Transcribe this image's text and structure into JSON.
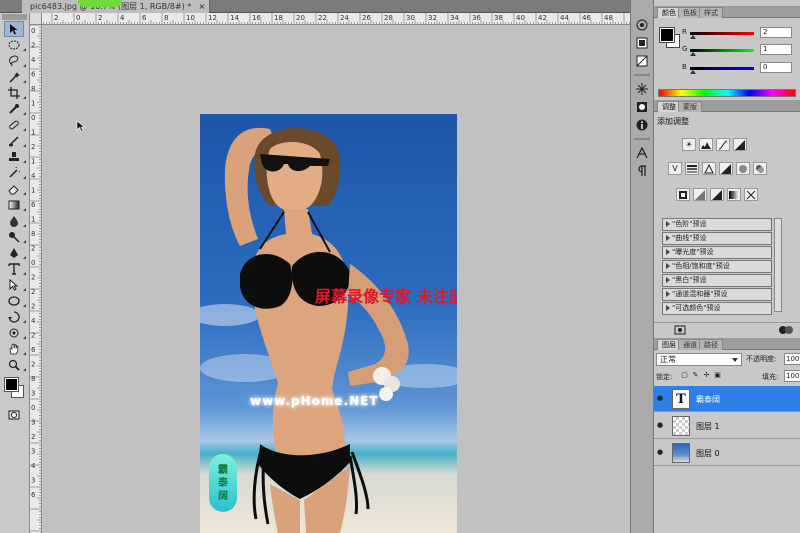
{
  "tabbar": {
    "doc_tab_label": "pic6483.jpg @ 16.7% (图层 1, RGB/8#) *",
    "close_glyph": "×"
  },
  "tools": [
    "move",
    "marquee",
    "lasso",
    "magic-wand",
    "crop",
    "eyedropper",
    "healing",
    "brush",
    "stamp",
    "history-brush",
    "eraser",
    "gradient",
    "blur",
    "dodge",
    "pen",
    "type",
    "path-select",
    "shape",
    "3d-rotate",
    "3d-camera",
    "hand",
    "zoom"
  ],
  "ruler": {
    "top_labels": [
      "4",
      "2",
      "0",
      "2",
      "4",
      "6",
      "8",
      "10",
      "12",
      "14",
      "16",
      "18",
      "20",
      "22",
      "24",
      "26",
      "28",
      "30",
      "32",
      "34",
      "36",
      "38",
      "40",
      "42",
      "44",
      "46",
      "48"
    ],
    "left_labels": [
      "0",
      "2",
      "4",
      "6",
      "8",
      "1",
      "0",
      "1",
      "2",
      "1",
      "4",
      "1",
      "6",
      "1",
      "8",
      "2",
      "0",
      "2",
      "2",
      "2",
      "4",
      "2",
      "6",
      "2",
      "8",
      "3",
      "0",
      "3",
      "2",
      "3",
      "4",
      "3",
      "6"
    ]
  },
  "canvas": {
    "watermark_text": "屏幕录像专家 未注册",
    "site_text": "www.pHome.NET",
    "seal_chars": [
      "霸",
      "泰",
      "阔"
    ]
  },
  "strip": {
    "icons": [
      "color-panel-icon",
      "swatches-icon",
      "styles-icon",
      "adjustments-icon",
      "masks-icon",
      "info-icon",
      "character-icon",
      "paragraph-icon"
    ]
  },
  "color_panel": {
    "tabs": [
      "颜色",
      "色板",
      "样式"
    ],
    "active_tab": 0,
    "channels": [
      {
        "label": "R",
        "value": "2",
        "color": "#d00000"
      },
      {
        "label": "G",
        "value": "1",
        "color": "#00a000"
      },
      {
        "label": "B",
        "value": "0",
        "color": "#0000c0"
      }
    ]
  },
  "adjustments_panel": {
    "tabs": [
      "调整",
      "蒙版"
    ],
    "active_tab": 0,
    "title": "添加调整",
    "presets": [
      "\"色阶\"预设",
      "\"曲线\"预设",
      "\"曝光度\"预设",
      "\"色相/饱和度\"预设",
      "\"黑白\"预设",
      "\"通道混和器\"预设",
      "\"可选颜色\"预设"
    ]
  },
  "layers_panel": {
    "tabs": [
      "图层",
      "通道",
      "路径"
    ],
    "active_tab": 0,
    "blend_mode": "正常",
    "opacity_label": "不透明度:",
    "opacity_value": "100%",
    "lock_label": "锁定:",
    "fill_label": "填充:",
    "fill_value": "100%",
    "layers": [
      {
        "name": "霸泰阔",
        "thumb": "T",
        "selected": true
      },
      {
        "name": "图层 1",
        "thumb": "",
        "selected": false
      },
      {
        "name": "图层 0",
        "thumb": "",
        "selected": false
      }
    ]
  },
  "colors": {
    "selected_layer": "#2f7fe8",
    "watermark_red": "#e4152a",
    "tab_flag_green": "#6fdc3a"
  }
}
